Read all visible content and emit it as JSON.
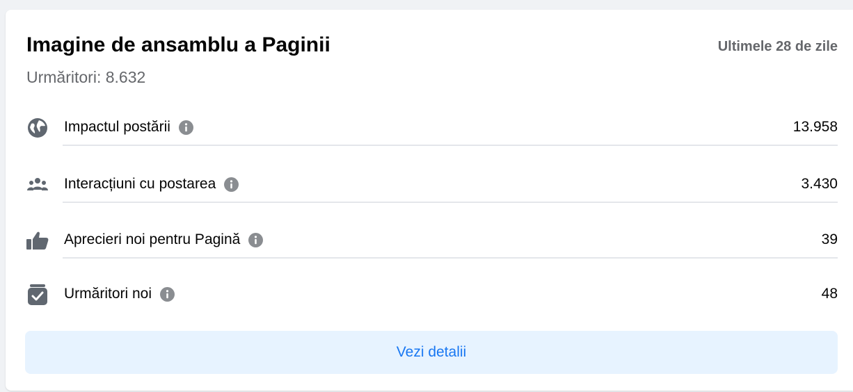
{
  "overview": {
    "title": "Imagine de ansamblu a Paginii",
    "period": "Ultimele 28 de zile",
    "followers": "Urmăritori: 8.632"
  },
  "metrics": [
    {
      "label": "Impactul postării",
      "value": "13.958",
      "icon": "globe-icon"
    },
    {
      "label": "Interacțiuni cu postarea",
      "value": "3.430",
      "icon": "people-icon"
    },
    {
      "label": "Aprecieri noi pentru Pagină",
      "value": "39",
      "icon": "thumbs-up-icon"
    },
    {
      "label": "Urmăritori noi",
      "value": "48",
      "icon": "follow-check-icon"
    }
  ],
  "actions": {
    "details_label": "Vezi detalii"
  },
  "colors": {
    "accent": "#1877f2",
    "button_bg": "#e7f3ff",
    "icon_gray": "#606770",
    "muted_text": "#65676b"
  }
}
